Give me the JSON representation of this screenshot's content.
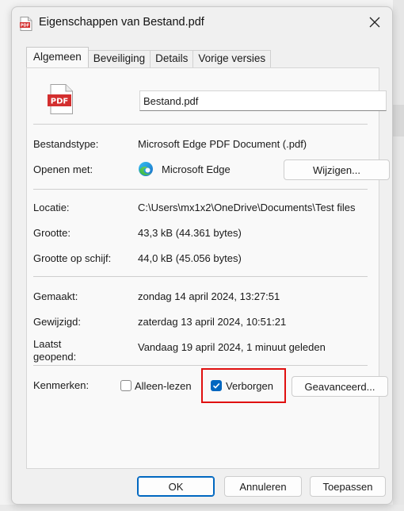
{
  "window": {
    "title": "Eigenschappen van Bestand.pdf"
  },
  "tabs": [
    {
      "label": "Algemeen",
      "active": true
    },
    {
      "label": "Beveiliging",
      "active": false
    },
    {
      "label": "Details",
      "active": false
    },
    {
      "label": "Vorige versies",
      "active": false
    }
  ],
  "general": {
    "file_icon_text": "PDF",
    "filename": "Bestand.pdf",
    "type_label": "Bestandstype:",
    "type_value": "Microsoft Edge PDF Document (.pdf)",
    "opens_label": "Openen met:",
    "opens_value": "Microsoft Edge",
    "change_button": "Wijzigen...",
    "location_label": "Locatie:",
    "location_value": "C:\\Users\\mx1x2\\OneDrive\\Documents\\Test files",
    "size_label": "Grootte:",
    "size_value": "43,3 kB (44.361 bytes)",
    "disk_label": "Grootte op schijf:",
    "disk_value": "44,0 kB (45.056 bytes)",
    "created_label": "Gemaakt:",
    "created_value": "zondag 14 april 2024, 13:27:51",
    "modified_label": "Gewijzigd:",
    "modified_value": "zaterdag 13 april 2024, 10:51:21",
    "accessed_label_1": "Laatst",
    "accessed_label_2": "geopend:",
    "accessed_value": "Vandaag 19 april 2024, 1 minuut geleden",
    "attributes_label": "Kenmerken:",
    "readonly_label": "Alleen-lezen",
    "readonly_checked": false,
    "hidden_label": "Verborgen",
    "hidden_checked": true,
    "advanced_button": "Geavanceerd..."
  },
  "footer": {
    "ok": "OK",
    "cancel": "Annuleren",
    "apply": "Toepassen"
  },
  "colors": {
    "accent": "#0067c0",
    "highlight": "#e01010",
    "pdf_red": "#d32f2f"
  }
}
